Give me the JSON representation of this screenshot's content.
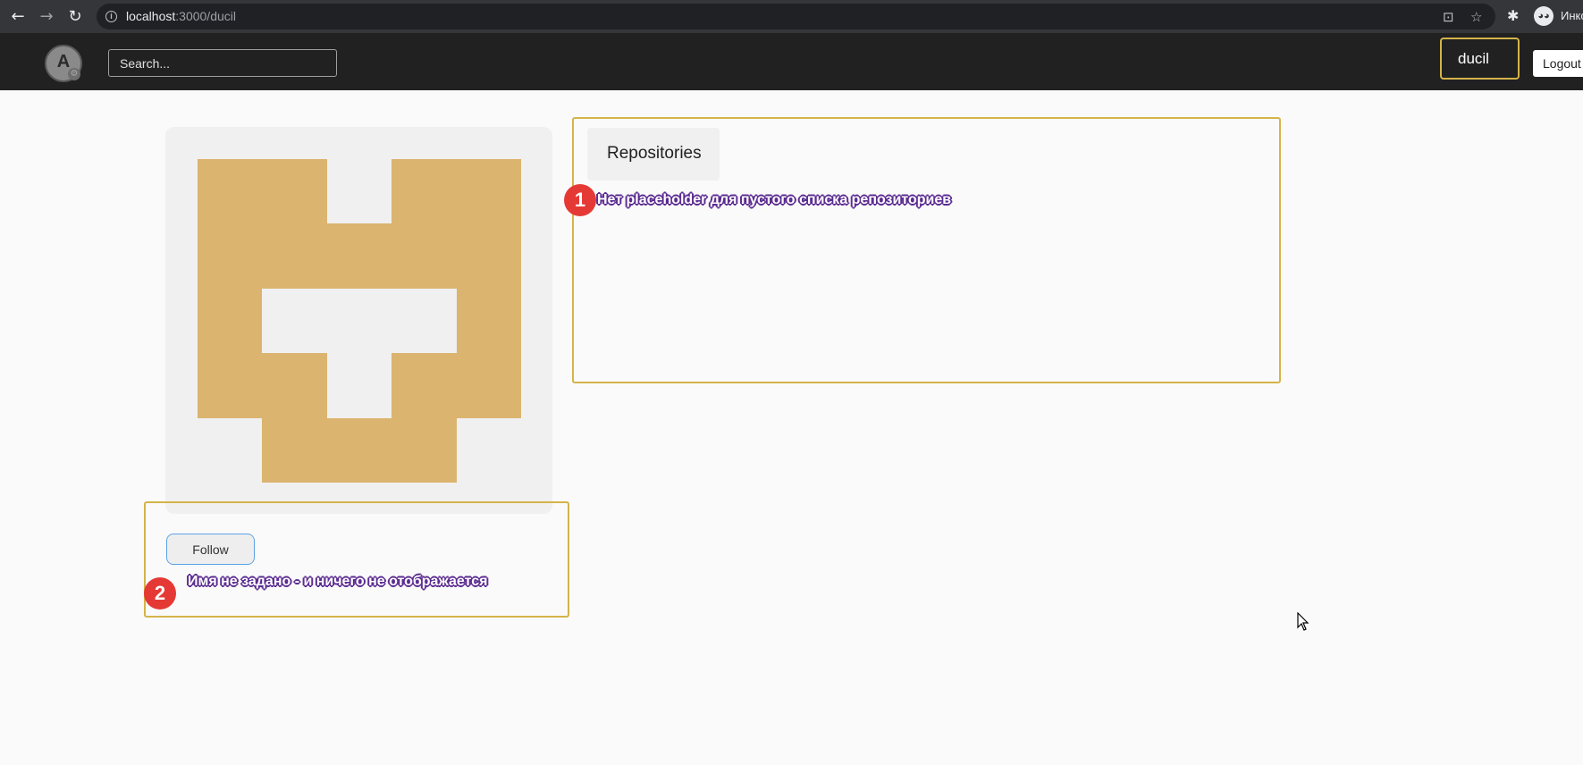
{
  "browser": {
    "url_host": "localhost",
    "url_rest": ":3000/ducil",
    "profile_label": "Инко"
  },
  "header": {
    "logo_letter": "A",
    "search_placeholder": "Search...",
    "user_label": "ducil",
    "logout_label": "Logout"
  },
  "profile": {
    "follow_label": "Follow",
    "avatar_color": "#dbb46f"
  },
  "repositories": {
    "tab_label": "Repositories"
  },
  "annotations": [
    {
      "number": "1",
      "text": "Нет placeholder для пустого списка репозиториев"
    },
    {
      "number": "2",
      "text": "Имя не задано - и ничего не отображается"
    }
  ],
  "colors": {
    "accent_border": "#d4b44a",
    "header_bg": "#212121",
    "marker_red": "#e53935"
  }
}
